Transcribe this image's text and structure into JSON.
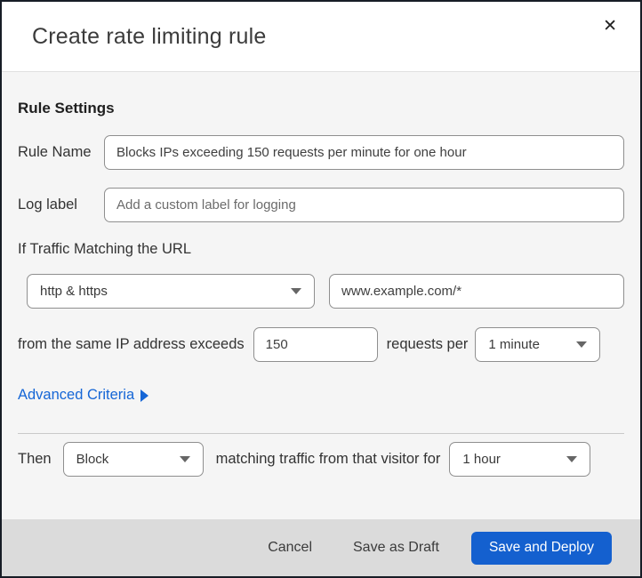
{
  "dialog": {
    "title": "Create rate limiting rule",
    "close_icon": "✕"
  },
  "rule_settings": {
    "heading": "Rule Settings",
    "rule_name": {
      "label": "Rule Name",
      "value": "Blocks IPs exceeding 150 requests per minute for one hour"
    },
    "log_label": {
      "label": "Log label",
      "placeholder": "Add a custom label for logging"
    }
  },
  "traffic_match": {
    "intro": "If Traffic Matching the URL",
    "scheme_selected": "http & https",
    "url_value": "www.example.com/*",
    "threshold_prefix": "from the same IP address exceeds",
    "threshold_value": "150",
    "threshold_suffix": "requests per",
    "period_selected": "1 minute"
  },
  "advanced_criteria": {
    "label": "Advanced Criteria"
  },
  "action": {
    "prefix": "Then",
    "action_selected": "Block",
    "middle": "matching traffic from that visitor for",
    "duration_selected": "1 hour"
  },
  "footer": {
    "cancel_label": "Cancel",
    "save_draft_label": "Save as Draft",
    "save_deploy_label": "Save and Deploy"
  },
  "colors": {
    "accent_link_blue": "#1566d6",
    "primary_button_blue": "#1460cf",
    "body_background": "#f5f5f5",
    "footer_background": "#dbdbdb"
  }
}
